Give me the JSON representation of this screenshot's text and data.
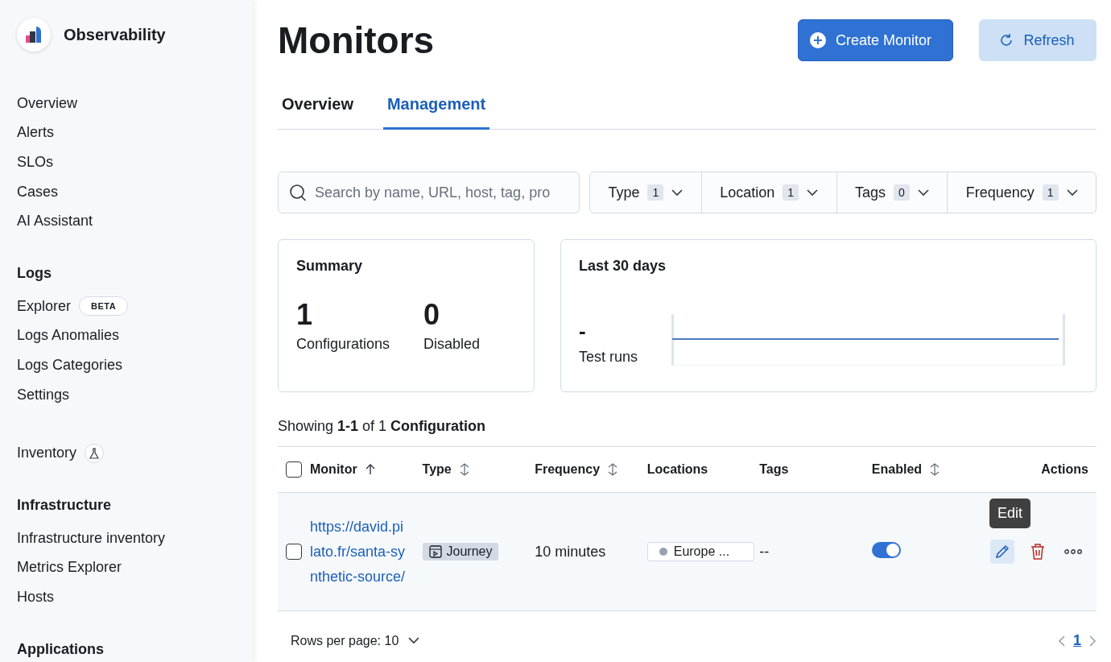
{
  "sidebar": {
    "app_title": "Observability",
    "groups": [
      {
        "items": [
          {
            "label": "Overview"
          },
          {
            "label": "Alerts"
          },
          {
            "label": "SLOs"
          },
          {
            "label": "Cases"
          },
          {
            "label": "AI Assistant"
          }
        ]
      },
      {
        "title": "Logs",
        "items": [
          {
            "label": "Explorer",
            "badge": "BETA"
          },
          {
            "label": "Logs Anomalies"
          },
          {
            "label": "Logs Categories"
          },
          {
            "label": "Settings"
          }
        ]
      },
      {
        "items": [
          {
            "label": "Inventory",
            "kind": "technical-preview"
          }
        ]
      },
      {
        "title": "Infrastructure",
        "items": [
          {
            "label": "Infrastructure inventory"
          },
          {
            "label": "Metrics Explorer"
          },
          {
            "label": "Hosts"
          }
        ]
      },
      {
        "title": "Applications"
      }
    ]
  },
  "page": {
    "title": "Monitors",
    "buttons": [
      {
        "label": "Create Monitor",
        "kind": "primary"
      },
      {
        "label": "Refresh",
        "kind": "secondary"
      }
    ]
  },
  "tabs": [
    {
      "label": "Overview",
      "selected": false
    },
    {
      "label": "Management",
      "selected": true
    }
  ],
  "search": {
    "placeholder": "Search by name, URL, host, tag, pro"
  },
  "filters": [
    {
      "label": "Type",
      "count": "1"
    },
    {
      "label": "Location",
      "count": "1"
    },
    {
      "label": "Tags",
      "count": "0"
    },
    {
      "label": "Frequency",
      "count": "1"
    }
  ],
  "summary": {
    "title": "Summary",
    "stats": [
      {
        "value": "1",
        "label": "Configurations"
      },
      {
        "value": "0",
        "label": "Disabled"
      }
    ]
  },
  "last_30_days": {
    "title": "Last 30 days",
    "value": "-",
    "label": "Test runs"
  },
  "showing": "Showing **1-1** of 1 **Configuration**",
  "table": {
    "columns": [
      {
        "label": "Monitor",
        "sortable": true,
        "sorted": true
      },
      {
        "label": "Type",
        "sortable": true,
        "sorted": false
      },
      {
        "label": "Frequency",
        "sortable": true,
        "sorted": false
      },
      {
        "label": "Locations",
        "sortable": false
      },
      {
        "label": "Tags",
        "sortable": false
      },
      {
        "label": "Enabled",
        "sortable": true,
        "sorted": false
      },
      {
        "label": "Actions",
        "sortable": false
      }
    ],
    "header_checked": false,
    "rows": [
      {
        "checked": false,
        "monitor": "https://david.pilato.fr/santa-synthetic-source/",
        "type": "Journey",
        "frequency": "10 minutes",
        "location": "Europe ...",
        "tags": "--",
        "enabled": true,
        "tooltip": "Edit"
      }
    ]
  },
  "pagination": {
    "rows_per_page": "Rows per page: 10",
    "pages": [
      {
        "label": "1",
        "selected": true
      }
    ]
  }
}
